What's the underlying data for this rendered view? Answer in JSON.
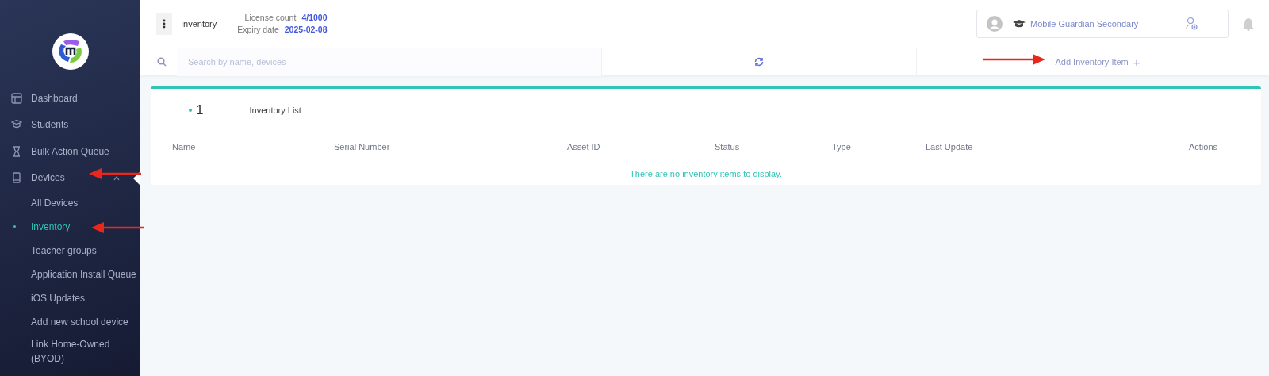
{
  "sidebar": {
    "items": [
      {
        "label": "Dashboard",
        "selected": false
      },
      {
        "label": "Students",
        "selected": false
      },
      {
        "label": "Bulk Action Queue",
        "selected": false
      },
      {
        "label": "Devices",
        "selected": false,
        "expanded": true,
        "children": [
          {
            "label": "All Devices",
            "selected": false
          },
          {
            "label": "Inventory",
            "selected": true
          },
          {
            "label": "Teacher groups",
            "selected": false
          },
          {
            "label": "Application Install Queue",
            "selected": false
          },
          {
            "label": "iOS Updates",
            "selected": false
          },
          {
            "label": "Add new school device",
            "selected": false
          },
          {
            "label": "Link Home-Owned (BYOD)",
            "selected": false
          }
        ]
      }
    ]
  },
  "header": {
    "page_title": "Inventory",
    "license_label": "License count",
    "license_value": "4/1000",
    "expiry_label": "Expiry date",
    "expiry_value": "2025-02-08",
    "school": "Mobile Guardian Secondary"
  },
  "toolbar": {
    "search": {
      "placeholder": "Search by name, devices"
    },
    "add_button": "Add Inventory Item",
    "add_icon": "+"
  },
  "card": {
    "count": "1",
    "title": "Inventory List",
    "columns": [
      "Name",
      "Serial Number",
      "Asset ID",
      "Status",
      "Type",
      "Last Update",
      "Actions"
    ],
    "empty_message": "There are no inventory items to display."
  }
}
